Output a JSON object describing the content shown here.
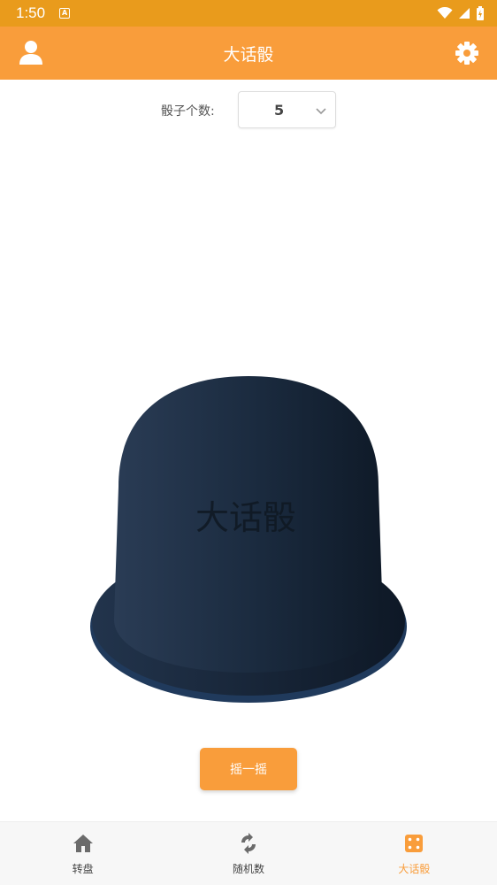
{
  "status_bar": {
    "time": "1:50",
    "notif_letter": "A"
  },
  "app_bar": {
    "title": "大话骰"
  },
  "dice_count": {
    "label": "骰子个数:",
    "value": "5"
  },
  "cup": {
    "label": "大话骰"
  },
  "shake_button": {
    "label": "摇一摇"
  },
  "bottom_nav": {
    "items": [
      {
        "label": "转盘",
        "icon": "home-icon",
        "active": false
      },
      {
        "label": "随机数",
        "icon": "refresh-icon",
        "active": false
      },
      {
        "label": "大话骰",
        "icon": "dice-icon",
        "active": true
      }
    ]
  },
  "colors": {
    "status_bar": "#E99B1C",
    "accent": "#F99D3B",
    "cup_dark": "#1B2A3D",
    "nav_inactive": "#6b6b6b"
  }
}
